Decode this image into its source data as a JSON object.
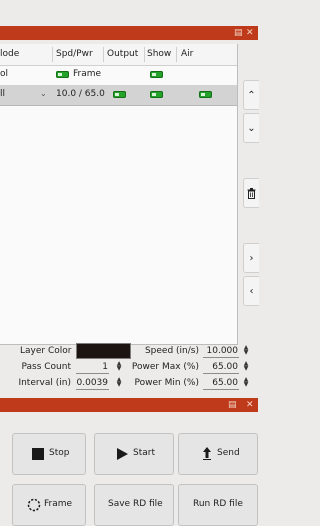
{
  "window": {
    "restore_icon": "restore-icon",
    "close_icon": "close-icon"
  },
  "cut_list": {
    "headers": [
      "lode",
      "Spd/Pwr",
      "Output",
      "Show",
      "Air"
    ],
    "row1": {
      "mode": "ol",
      "spdpwr": "Frame"
    },
    "row2": {
      "mode": "ll",
      "spdpwr": "10.0 / 65.0"
    }
  },
  "side_buttons": [
    "chevron-up-icon",
    "chevron-down-icon",
    "trash-icon",
    "chevron-right-icon",
    "chevron-left-icon"
  ],
  "settings": {
    "layer_color_label": "Layer Color",
    "layer_color": "#1b1410",
    "pass_count_label": "Pass Count",
    "pass_count": "1",
    "interval_label": "Interval (in)",
    "interval": "0.0039",
    "speed_label": "Speed (in/s)",
    "speed": "10.000",
    "power_max_label": "Power Max (%)",
    "power_max": "65.00",
    "power_min_label": "Power Min (%)",
    "power_min": "65.00"
  },
  "laser": {
    "stop": "Stop",
    "start": "Start",
    "send": "Send",
    "frame": "Frame",
    "save_rd": "Save RD file",
    "run_rd": "Run RD file"
  },
  "colors": {
    "titlebar": "#bf3a1a",
    "toggle_on": "#25a229",
    "selected_row": "#d3d3d3"
  }
}
